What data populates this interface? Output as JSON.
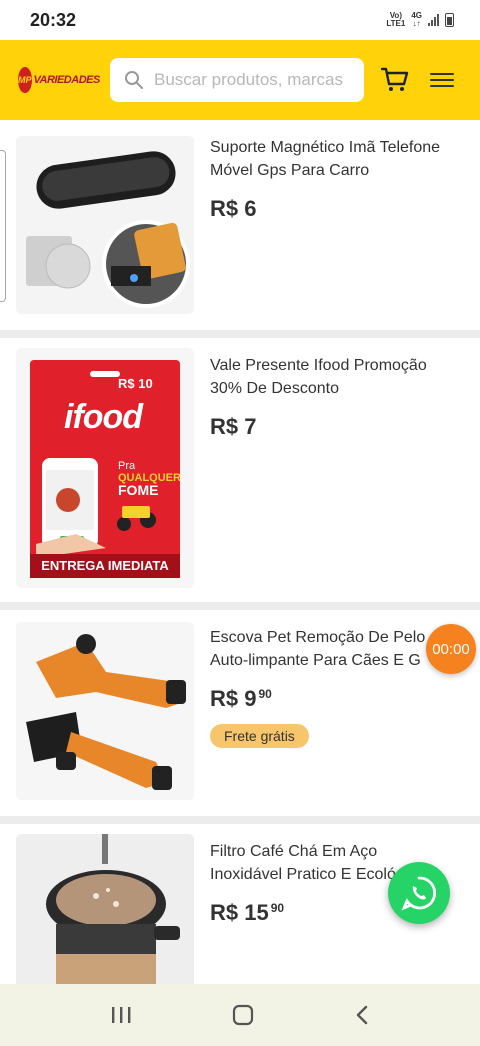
{
  "status_bar": {
    "time": "20:32",
    "network_top": "Vo)",
    "network_bottom": "LTE1",
    "data_type": "4G"
  },
  "header": {
    "logo_text": "VARIEDADES",
    "logo_mark": "MP",
    "search_placeholder": "Buscar produtos, marcas",
    "brand_color": "#ffd20a"
  },
  "products": [
    {
      "title": "Suporte Magnético Imã Telefone\nMóvel Gps Para Carro",
      "price": "R$ 6",
      "price_cents": "",
      "image": "magnetic-phone-holder-image"
    },
    {
      "title": "Vale Presente Ifood Promoção\n30% De Desconto",
      "price": "R$ 7",
      "price_cents": "",
      "image": "ifood-gift-card-image",
      "card_value": "R$ 10",
      "card_brand": "ifood",
      "card_tagline_1": "Pra",
      "card_tagline_2": "QUALQUER",
      "card_tagline_3": "FOME",
      "card_banner": "ENTREGA IMEDIATA"
    },
    {
      "title": "Escova Pet Remoção De Pelo\nAuto-limpante Para Cães E G",
      "price": "R$ 9",
      "price_cents": "90",
      "badge": "Frete grátis",
      "image": "pet-brush-image"
    },
    {
      "title": "Filtro Café Chá Em Aço\nInoxidável Pratico E Ecológico",
      "price": "R$ 15",
      "price_cents": "90",
      "image": "coffee-filter-image"
    }
  ],
  "overlay": {
    "timer": "00:00"
  },
  "colors": {
    "timer_bg": "#f5811f",
    "whatsapp": "#25d366",
    "badge": "#f7c56b",
    "ifood_red": "#e0202a"
  }
}
